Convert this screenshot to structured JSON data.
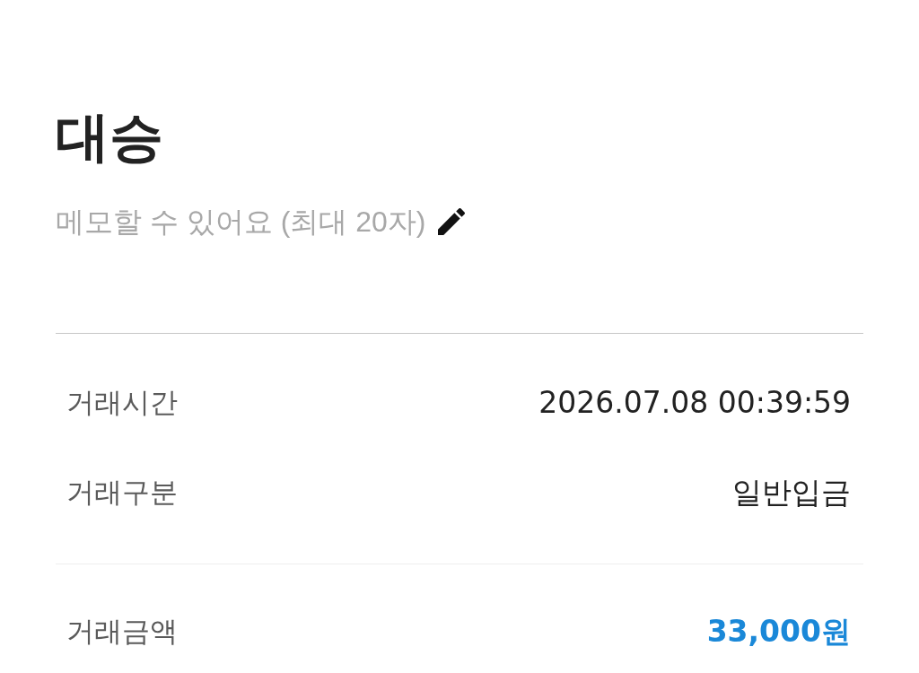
{
  "header": {
    "title": "대승",
    "memo_prompt": "메모할 수 있어요 (최대 20자)"
  },
  "detail_groups": [
    {
      "rows": [
        {
          "kind": "plain",
          "label": "거래시간",
          "value": "2026.07.08 00:39:59"
        },
        {
          "kind": "plain",
          "label": "거래구분",
          "value": "일반입금"
        }
      ]
    },
    {
      "rows": [
        {
          "kind": "amount",
          "label": "거래금액",
          "value": "33,000원"
        }
      ]
    }
  ]
}
